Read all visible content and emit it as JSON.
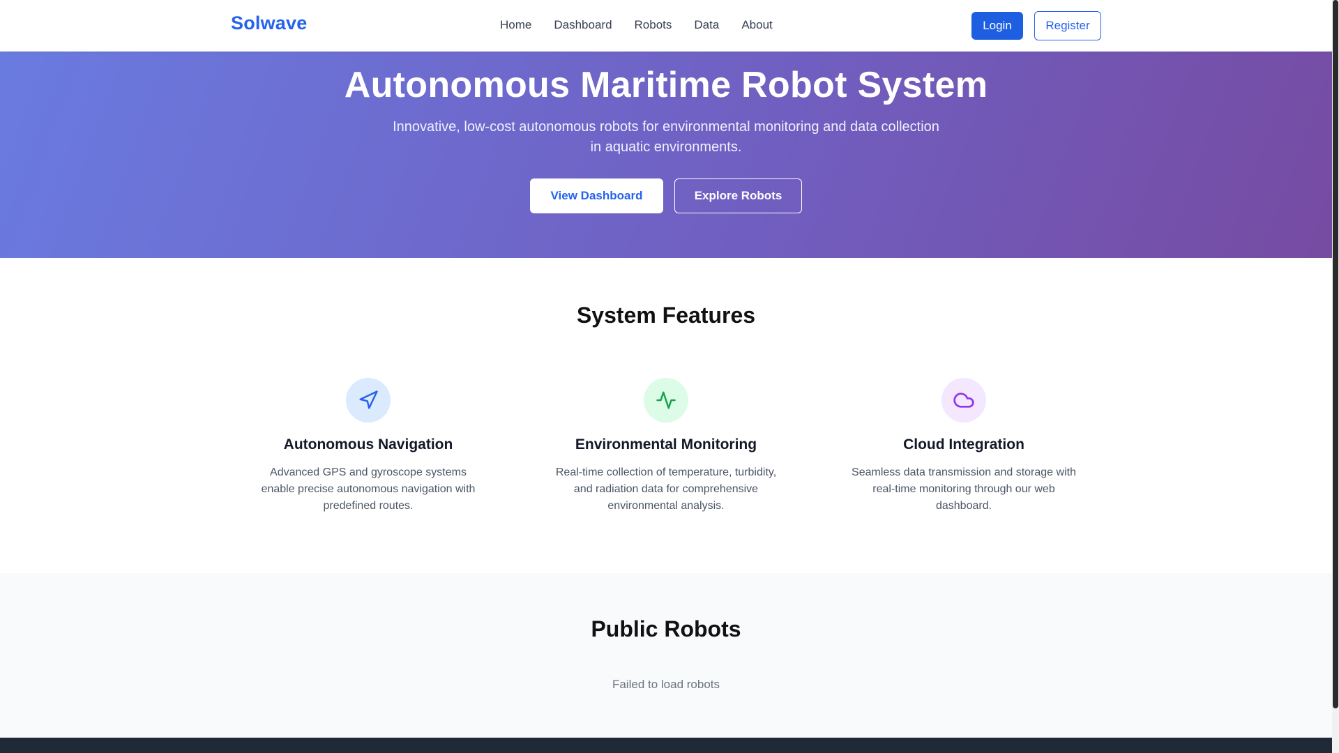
{
  "nav": {
    "brand": "Solwave",
    "links": [
      "Home",
      "Dashboard",
      "Robots",
      "Data",
      "About"
    ],
    "login_label": "Login",
    "register_label": "Register"
  },
  "hero": {
    "title": "Autonomous Maritime Robot System",
    "subtitle": "Innovative, low-cost autonomous robots for environmental monitoring and data collection in aquatic environments.",
    "primary_button": "View Dashboard",
    "secondary_button": "Explore Robots"
  },
  "features": {
    "title": "System Features",
    "items": [
      {
        "icon": "navigation-arrow-icon",
        "title": "Autonomous Navigation",
        "description": "Advanced GPS and gyroscope systems enable precise autonomous navigation with predefined routes.",
        "icon_color": "#2563eb",
        "icon_bg": "#dbeafe"
      },
      {
        "icon": "activity-pulse-icon",
        "title": "Environmental Monitoring",
        "description": "Real-time collection of temperature, turbidity, and radiation data for comprehensive environmental analysis.",
        "icon_color": "#16a34a",
        "icon_bg": "#dcfce7"
      },
      {
        "icon": "cloud-icon",
        "title": "Cloud Integration",
        "description": "Seamless data transmission and storage with real-time monitoring through our web dashboard.",
        "icon_color": "#9333ea",
        "icon_bg": "#f3e8ff"
      }
    ]
  },
  "public_robots": {
    "title": "Public Robots",
    "status": "Failed to load robots"
  },
  "colors": {
    "brand": "#2563eb",
    "hero_gradient_start": "#667eea",
    "hero_gradient_end": "#764ba2",
    "footer": "#1f2937"
  }
}
